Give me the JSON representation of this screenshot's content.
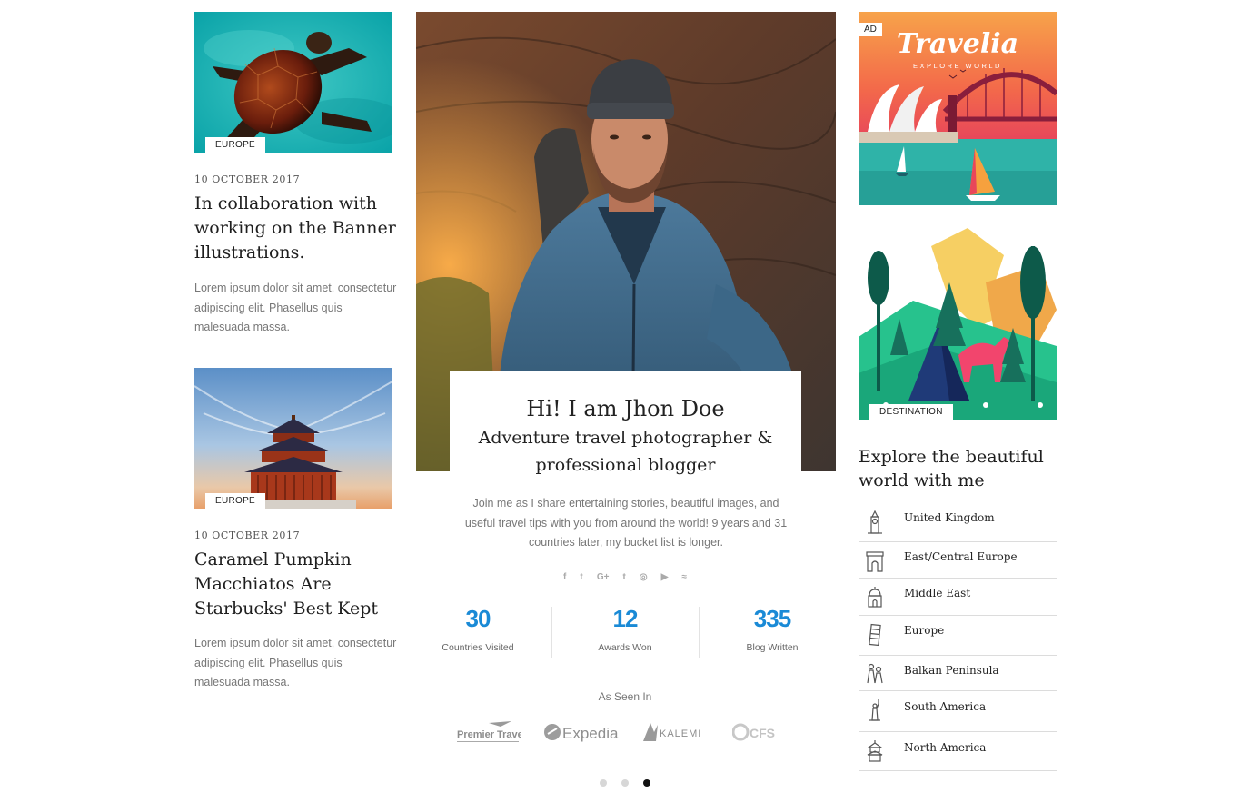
{
  "posts": [
    {
      "category": "EUROPE",
      "date": "10 OCTOBER 2017",
      "title": "In collaboration with working on the Banner illustrations.",
      "excerpt": "Lorem ipsum dolor sit amet, consectetur adipiscing elit. Phasellus quis malesuada massa."
    },
    {
      "category": "EUROPE",
      "date": "10 OCTOBER 2017",
      "title": "Caramel Pumpkin Macchiatos Are Starbucks' Best Kept",
      "excerpt": "Lorem ipsum dolor sit amet, consectetur adipiscing elit. Phasellus quis malesuada massa."
    }
  ],
  "intro": {
    "title": "Hi! I am Jhon Doe",
    "subtitle": "Adventure travel photographer & professional blogger",
    "text": "Join me as I share entertaining stories, beautiful images, and useful travel tips with you from around the world! 9 years and 31 countries later, my bucket list is longer."
  },
  "social": [
    "f",
    "t",
    "G+",
    "t",
    "◎",
    "▶",
    "≈"
  ],
  "stats": [
    {
      "value": "30",
      "label": "Countries Visited"
    },
    {
      "value": "12",
      "label": "Awards Won"
    },
    {
      "value": "335",
      "label": "Blog Written"
    }
  ],
  "as_seen": {
    "heading": "As Seen In",
    "logos": [
      "Premier Travel",
      "Expedia",
      "KALEMI",
      "CFS"
    ]
  },
  "ad": {
    "tag": "AD",
    "brand": "Travelia",
    "tagline": "EXPLORE WORLD"
  },
  "destination_tag": "DESTINATION",
  "explore_title": "Explore the beautiful world with me",
  "regions": [
    {
      "label": "United Kingdom",
      "icon": "big-ben-icon"
    },
    {
      "label": "East/Central Europe",
      "icon": "arch-icon"
    },
    {
      "label": "Middle East",
      "icon": "taj-mahal-icon"
    },
    {
      "label": "Europe",
      "icon": "leaning-tower-icon"
    },
    {
      "label": "Balkan Peninsula",
      "icon": "statues-icon"
    },
    {
      "label": "South America",
      "icon": "statue-of-liberty-icon"
    },
    {
      "label": "North America",
      "icon": "pagoda-icon"
    }
  ],
  "slider": {
    "pages": 3,
    "active": 3
  },
  "colors": {
    "accent": "#1a8ad6",
    "text": "#1e1e1e",
    "muted": "#777777",
    "divider": "#dcdcdc"
  }
}
